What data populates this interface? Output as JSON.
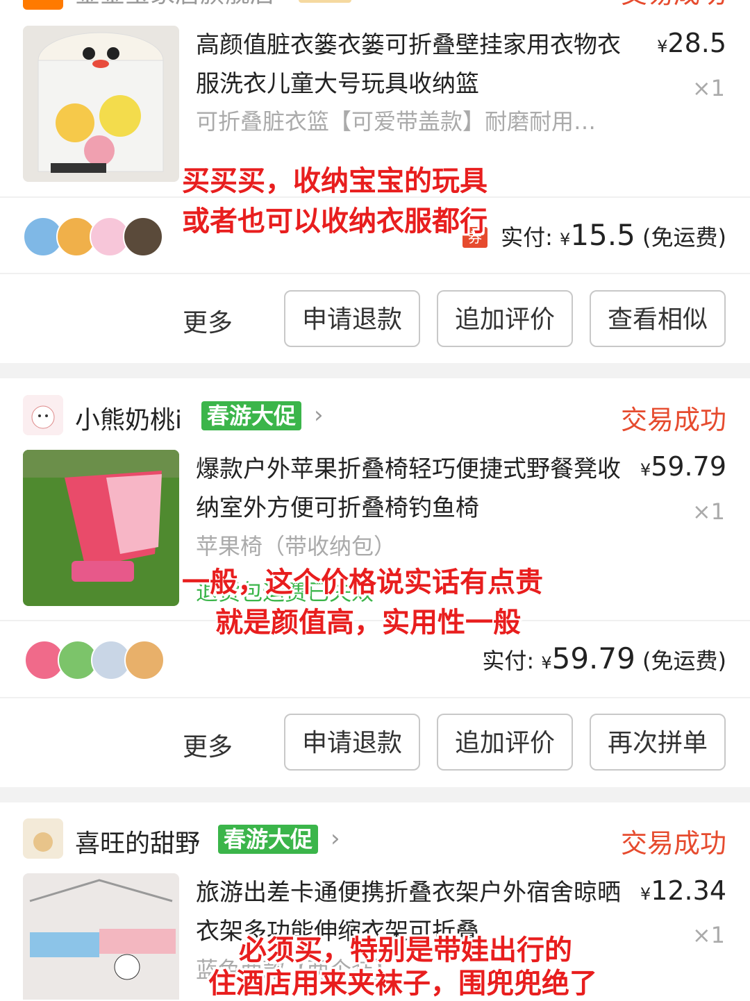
{
  "top_cut": {
    "status": "交易成功",
    "shop_name": "金金宝家居旗舰店"
  },
  "orders": [
    {
      "title": "高颜值脏衣篓衣篓可折叠壁挂家用衣物衣服洗衣儿童大号玩具收纳篮",
      "sku": "可折叠脏衣篮【可爱带盖款】耐磨耐用…",
      "currency": "¥",
      "price": "28.5",
      "qty": "×1",
      "paid_label": "实付:",
      "paid_amount": "15.5",
      "shipping": "(免运费)",
      "coupon_label": "券",
      "buttons": {
        "more": "更多",
        "b1": "申请退款",
        "b2": "追加评价",
        "b3": "查看相似"
      },
      "annotation_lines": [
        "买买买，收纳宝宝的玩具",
        "或者也可以收纳衣服都行"
      ]
    },
    {
      "shop_name": "小熊奶桃i",
      "promo": "春游大促",
      "status": "交易成功",
      "title": "爆款户外苹果折叠椅轻巧便捷式野餐凳收纳室外方便可折叠椅钓鱼椅",
      "sku": "苹果椅（带收纳包）",
      "notice": "退货包运费已失效",
      "currency": "¥",
      "price": "59.79",
      "qty": "×1",
      "paid_label": "实付:",
      "paid_amount": "59.79",
      "shipping": "(免运费)",
      "buttons": {
        "more": "更多",
        "b1": "申请退款",
        "b2": "追加评价",
        "b3": "再次拼单"
      },
      "annotation_lines": [
        "一般，这个价格说实话有点贵",
        "就是颜值高，实用性一般"
      ]
    },
    {
      "shop_name": "喜旺的甜野",
      "promo": "春游大促",
      "status": "交易成功",
      "title": "旅游出差卡通便携折叠衣架户外宿舍晾晒衣架多功能伸缩衣架可折叠",
      "sku": "蓝色两款【两个装】",
      "currency": "¥",
      "price": "12.34",
      "qty": "×1",
      "annotation_lines": [
        "必须买，特别是带娃出行的",
        "住酒店用来夹袜子，围兜兜绝了"
      ]
    }
  ],
  "icons": {
    "chevron": "chevron-right-icon"
  },
  "colors": {
    "status": "#e64b2e",
    "promo": "#3bb54a",
    "annotation": "#e81e1e"
  }
}
